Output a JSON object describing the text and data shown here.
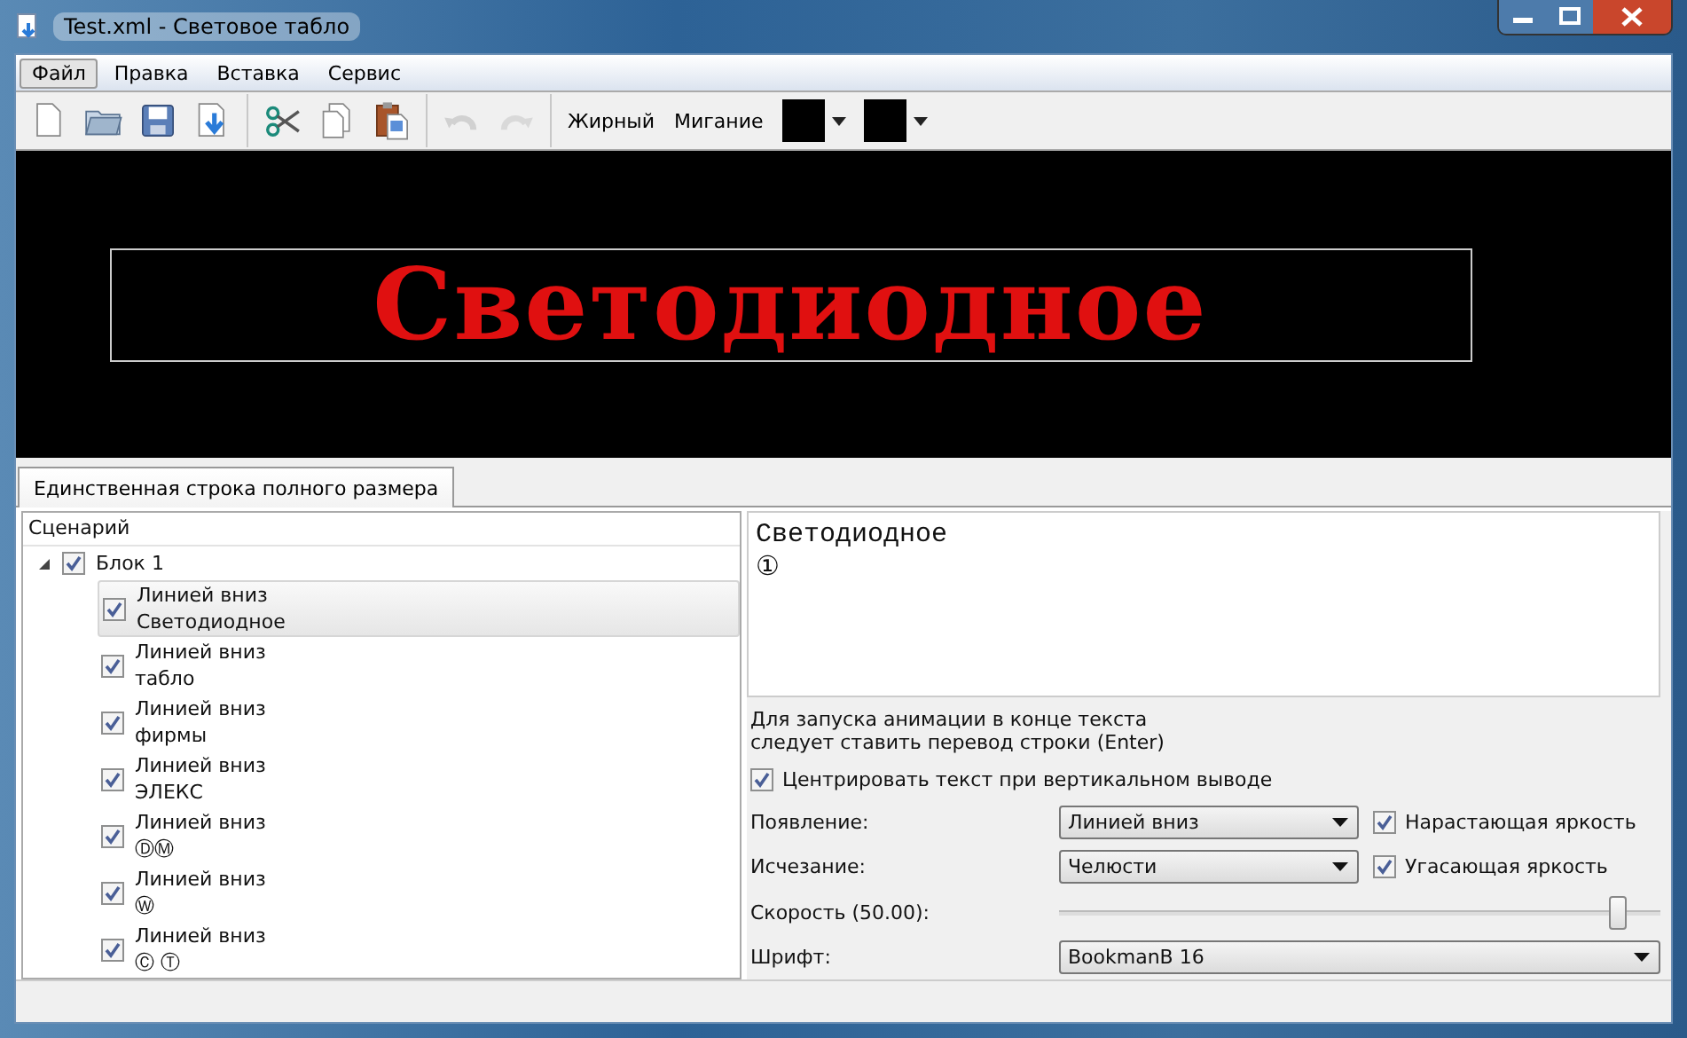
{
  "window": {
    "title": "Test.xml - Световое табло"
  },
  "menu": [
    {
      "label": "Файл",
      "selected": true
    },
    {
      "label": "Правка",
      "selected": false
    },
    {
      "label": "Вставка",
      "selected": false
    },
    {
      "label": "Сервис",
      "selected": false
    }
  ],
  "toolbar": {
    "tools": [
      {
        "disabled": false
      },
      {
        "disabled": false
      },
      {
        "disabled": false
      },
      {
        "disabled": false
      },
      {
        "disabled": false
      },
      {
        "disabled": false
      },
      {
        "disabled": false
      },
      {
        "disabled": true
      },
      {
        "disabled": true
      }
    ],
    "bold": "Жирный",
    "blink": "Мигание",
    "swatches": [
      {
        "color": "#000000"
      },
      {
        "color": "#000000"
      }
    ]
  },
  "display": {
    "text": "Светодиодное"
  },
  "tabs": [
    {
      "label": "Единственная строка полного размера",
      "selected": true
    }
  ],
  "scenario": {
    "header": "Сценарий",
    "tree": [
      {
        "label": "Блок 1",
        "checked": true,
        "expanded": true,
        "children": [
          {
            "lines": [
              "Линией вниз",
              "Светодиодное"
            ],
            "checked": true,
            "selected": true
          },
          {
            "lines": [
              "Линией вниз",
              "табло"
            ],
            "checked": true,
            "selected": false
          },
          {
            "lines": [
              "Линией вниз",
              "фирмы"
            ],
            "checked": true,
            "selected": false
          },
          {
            "lines": [
              "Линией вниз",
              "ЭЛЕКС"
            ],
            "checked": true,
            "selected": false
          },
          {
            "lines": [
              "Линией вниз",
              "ⒹⓂ"
            ],
            "checked": true,
            "selected": false
          },
          {
            "lines": [
              "Линией вниз",
              "Ⓦ"
            ],
            "checked": true,
            "selected": false
          },
          {
            "lines": [
              "Линией вниз",
              "Ⓒ Ⓣ"
            ],
            "checked": true,
            "selected": false
          }
        ]
      }
    ]
  },
  "editor": {
    "lines": [
      "Светодиодное",
      "①"
    ]
  },
  "hint": {
    "lines": [
      "Для запуска анимации в конце текста",
      "следует ставить перевод строки (Enter)"
    ]
  },
  "center_text": {
    "label": "Центрировать текст при вертикальном выводе",
    "checked": true
  },
  "settings": [
    {
      "kind": "combo",
      "label": "Появление:",
      "value": "Линией вниз",
      "option": {
        "label": "Нарастающая яркость",
        "checked": true
      }
    },
    {
      "kind": "combo",
      "label": "Исчезание:",
      "value": "Челюсти",
      "option": {
        "label": "Угасающая яркость",
        "checked": true
      }
    },
    {
      "kind": "slider",
      "label": "Скорость (50.00):",
      "level": 0.93
    },
    {
      "kind": "wide",
      "label": "Шрифт:",
      "value": "BookmanB 16"
    }
  ]
}
